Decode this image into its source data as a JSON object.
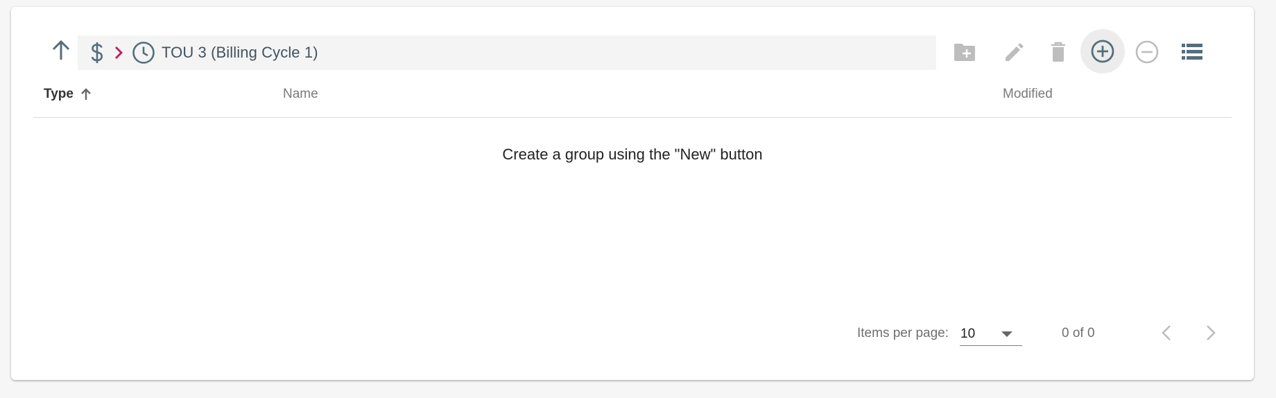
{
  "breadcrumb": {
    "up_icon": "arrow-up-icon",
    "root_icon": "dollar-icon",
    "separator_icon": "chevron-right-icon",
    "current_icon": "clock-icon",
    "current_title": "TOU 3 (Billing Cycle 1)",
    "separator_color": "#c2185b"
  },
  "toolbar": {
    "new_group_icon": "folder-add-icon",
    "edit_icon": "pencil-icon",
    "delete_icon": "trash-icon",
    "add_icon": "plus-circle-icon",
    "remove_icon": "minus-circle-icon",
    "list_view_icon": "list-view-icon"
  },
  "table": {
    "columns": [
      {
        "label": "Type",
        "sorted": "ascending"
      },
      {
        "label": "Name"
      },
      {
        "label": "Modified"
      }
    ],
    "empty_message": "Create a group using the \"New\" button"
  },
  "paginator": {
    "items_per_page_label": "Items per page:",
    "items_per_page_value": "10",
    "range_label": "0 of 0"
  },
  "colors": {
    "icon_dark": "#546e7a",
    "icon_disabled": "#bdbdbd",
    "accent": "#c2185b"
  }
}
